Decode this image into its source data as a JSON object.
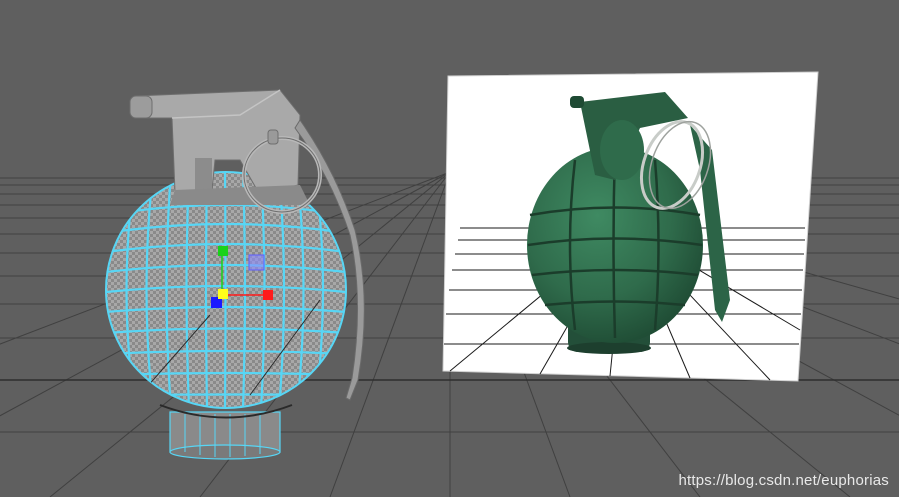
{
  "viewport": {
    "background": "#5f5f5f",
    "grid_color": "#3f3f3f",
    "wire_color": "#57d6f5",
    "model_shade": "#8f8f8f",
    "reference_bg": "#ffffff",
    "reference_grenade_color": "#2f6b4b"
  },
  "manipulator": {
    "handles": [
      {
        "name": "translate-y-handle",
        "color": "#19d219"
      },
      {
        "name": "translate-x-handle",
        "color": "#ff1b1b"
      },
      {
        "name": "translate-z-handle",
        "color": "#1919ff"
      },
      {
        "name": "center-handle",
        "color": "#ffff1a"
      },
      {
        "name": "plane-handle",
        "color": "#8c8cff"
      }
    ]
  },
  "watermark": {
    "text": "https://blog.csdn.net/euphorias"
  }
}
